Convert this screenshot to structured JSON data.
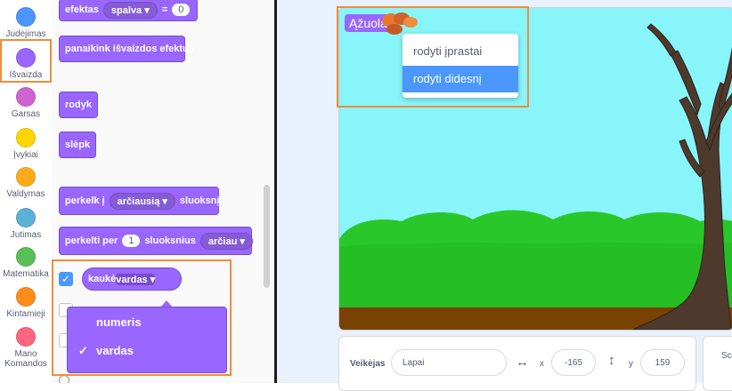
{
  "categories": [
    {
      "label": "Judėjimas",
      "color": "#4c97ff"
    },
    {
      "label": "Išvaizda",
      "color": "#9966ff"
    },
    {
      "label": "Garsas",
      "color": "#cf63cf"
    },
    {
      "label": "Įvykiai",
      "color": "#ffd500"
    },
    {
      "label": "Valdymas",
      "color": "#ffab19"
    },
    {
      "label": "Jutimas",
      "color": "#5cb1d6"
    },
    {
      "label": "Matematika",
      "color": "#59c059"
    },
    {
      "label": "Kintamieji",
      "color": "#ff8c1a"
    },
    {
      "label": "Mano Komandos",
      "color": "#ff6680"
    }
  ],
  "blocks": {
    "effect_label": "efektas",
    "effect_dropdown": "spalva",
    "effect_eq": "=",
    "effect_value": "0",
    "clear_effects": "panaikink išvaizdos efektus",
    "show": "rodyk",
    "hide": "slėpk",
    "front_back_prefix": "perkelk į",
    "front_back_dropdown": "arčiausią",
    "front_back_suffix": "sluoksnį",
    "layers_prefix": "perkelti per",
    "layers_value": "1",
    "layers_suffix": "sluoksnius",
    "layers_dropdown": "arčiau",
    "costume_label": "kaukė",
    "costume_dropdown": "vardas"
  },
  "costume_menu": {
    "options": [
      "numeris",
      "vardas"
    ],
    "checkmark": "✓"
  },
  "stage": {
    "sprite_label": "Ąžuolas",
    "menu_options": [
      "rodyti įprastai",
      "rodyti didesnį"
    ],
    "selected_option": "rodyti didesnį"
  },
  "sprite_info": {
    "sprite_label": "Veikėjas",
    "sprite_name": "Lapai",
    "x_label": "x",
    "x_value": "-165",
    "y_label": "y",
    "y_value": "159",
    "next_panel_text": "Sc"
  },
  "colors": {
    "looks": "#9966ff",
    "highlight": "#f08c3c",
    "sky": "#88f5fb",
    "grass": "#29c729",
    "ground": "#7a4200"
  }
}
